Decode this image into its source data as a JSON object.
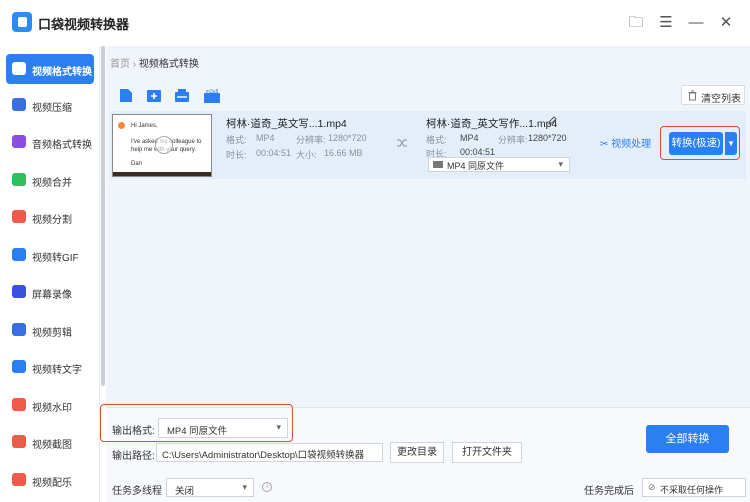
{
  "app": {
    "title": "口袋视频转换器"
  },
  "window": {
    "folder": "🗀",
    "menu": "☰",
    "minimize": "—",
    "close": "✕"
  },
  "sidebar": {
    "items": [
      {
        "label": "视频格式转换",
        "color": "#2b7ff2",
        "active": true
      },
      {
        "label": "视频压缩",
        "color": "#3b6fe0"
      },
      {
        "label": "音频格式转换",
        "color": "#8a4fe0"
      },
      {
        "label": "视频合并",
        "color": "#2fbf5f"
      },
      {
        "label": "视频分割",
        "color": "#ef5a4a"
      },
      {
        "label": "视频转GIF",
        "color": "#2b7ff2"
      },
      {
        "label": "屏幕录像",
        "color": "#3b4fe0"
      },
      {
        "label": "视频剪辑",
        "color": "#3b6fe0"
      },
      {
        "label": "视频转文字",
        "color": "#2b7ff2"
      },
      {
        "label": "视频水印",
        "color": "#ef5a4a"
      },
      {
        "label": "视频截图",
        "color": "#ef5a4a"
      },
      {
        "label": "视频配乐",
        "color": "#ef5a4a"
      }
    ]
  },
  "breadcrumb": {
    "home": "首页",
    "sep": "›",
    "current": "视频格式转换"
  },
  "toolbar": {
    "clear_label": "清空列表",
    "m3u8": "m3u8"
  },
  "file": {
    "thumb_lines": [
      "Hi James,",
      "I've asked my colleague to",
      "help me with your query.",
      "Dan"
    ],
    "source": {
      "name": "柯林·道奇_英文写...1.mp4",
      "format_k": "格式:",
      "format_v": "MP4",
      "res_k": "分辨率:",
      "res_v": "1280*720",
      "dur_k": "时长:",
      "dur_v": "00:04:51",
      "size_k": "大小:",
      "size_v": "16.66 MB"
    },
    "target": {
      "name": "柯林·道奇_英文写作...1.mp4",
      "format_k": "格式:",
      "format_v": "MP4",
      "res_k": "分辨率:",
      "res_v": "1280*720",
      "dur_k": "时长:",
      "dur_v": "00:04:51",
      "format_select": "MP4  同原文件"
    },
    "process_label": "视频处理",
    "convert_label": "转换(极速)"
  },
  "bottom": {
    "format_label": "输出格式:",
    "format_value": "MP4  同原文件",
    "path_label": "输出路径:",
    "path_value": "C:\\Users\\Administrator\\Desktop\\口袋视频转换器",
    "change_dir": "更改目录",
    "open_folder": "打开文件夹",
    "convert_all": "全部转换",
    "multi_label": "任务多线程",
    "multi_value": "关闭",
    "after_label": "任务完成后",
    "after_value": "不采取任何操作"
  },
  "colors": {
    "accent": "#2b7ff2",
    "highlight": "#e04a3a"
  }
}
